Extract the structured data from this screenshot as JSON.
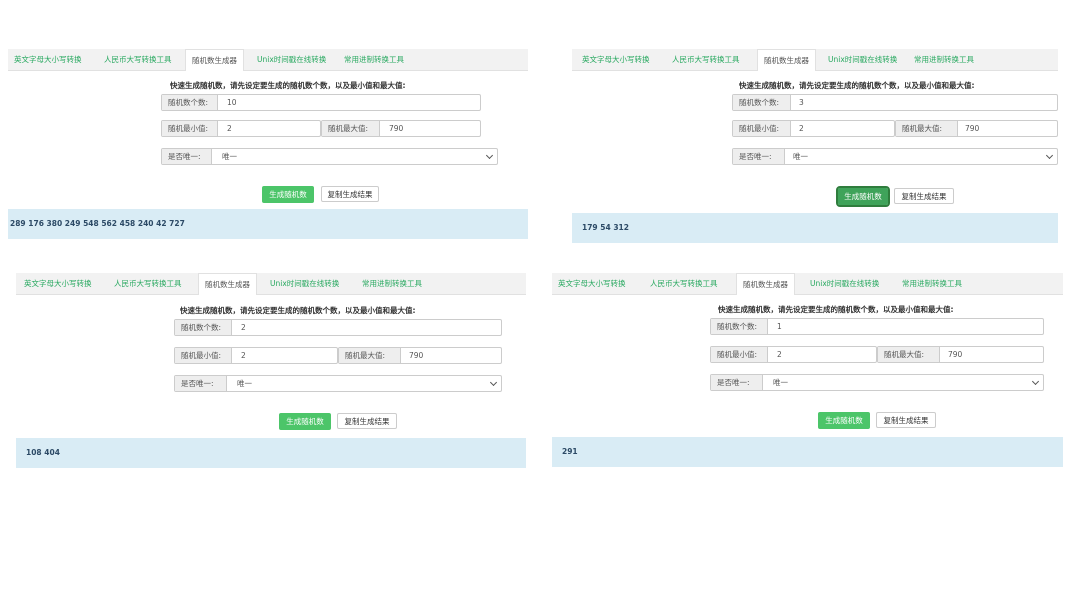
{
  "tabs": [
    "英文字母大小写转换",
    "人民币大写转换工具",
    "随机数生成器",
    "Unix时间戳在线转换",
    "常用进制转换工具"
  ],
  "form": {
    "hint": "快速生成随机数，请先设定要生成的随机数个数，以及最小值和最大值:",
    "count_label": "随机数个数:",
    "min_label": "随机最小值:",
    "max_label": "随机最大值:",
    "unique_label": "是否唯一:",
    "unique_value": "唯一",
    "generate_button": "生成随机数",
    "copy_button": "复制生成结果"
  },
  "panels": [
    {
      "count": "10",
      "min": "2",
      "max": "790",
      "result": "289 176 380 249 548 562 458 240 42 727"
    },
    {
      "count": "3",
      "min": "2",
      "max": "790",
      "result": "179 54 312"
    },
    {
      "count": "2",
      "min": "2",
      "max": "790",
      "result": "108 404"
    },
    {
      "count": "1",
      "min": "2",
      "max": "790",
      "result": "291"
    }
  ]
}
